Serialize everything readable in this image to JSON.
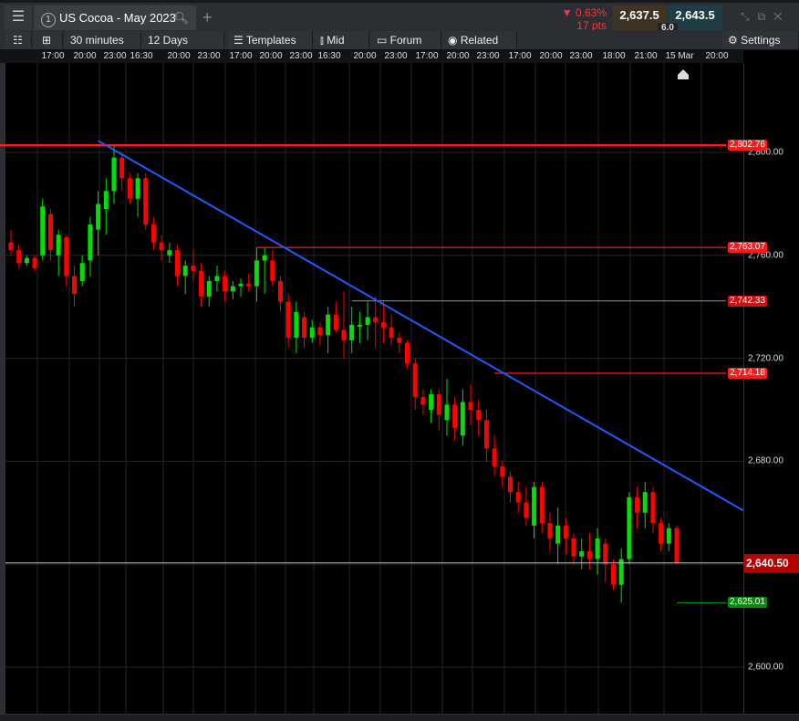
{
  "header": {
    "menu_icon": "hamburger-icon",
    "tab_number": "1",
    "title": "US Cocoa - May 2023",
    "add_tab": "+"
  },
  "quote": {
    "change_pct": "0.63%",
    "change_pts": "17 pts",
    "direction": "down",
    "sell": "2,637.5",
    "buy": "2,643.5",
    "spread": "6.0"
  },
  "toolbar": {
    "interval": "30 minutes",
    "range": "12 Days",
    "templates": "Templates",
    "price_type": "Mid",
    "forum": "Forum",
    "related": "Related",
    "settings": "Settings"
  },
  "chart_data": {
    "type": "candlestick",
    "time_labels": [
      "17:00",
      "20:00",
      "23:00",
      "16:30",
      "20:00",
      "23:00",
      "17:00",
      "20:00",
      "23:00",
      "16:30",
      "20:00",
      "23:00",
      "17:00",
      "20:00",
      "23:00",
      "17:00",
      "20:00",
      "23:00",
      "18:00",
      "21:00",
      "15 Mar",
      "20:00"
    ],
    "y_ticks": [
      "2,800.00",
      "2,760.00",
      "2,720.00",
      "2,680.00",
      "2,640.00",
      "2,600.00"
    ],
    "y_tick_values": [
      2800,
      2760,
      2720,
      2680,
      2640,
      2600
    ],
    "ylim": [
      2583,
      2835
    ],
    "grid": true,
    "colors": {
      "up": "#00e000",
      "down": "#ff0000",
      "trendline": "#1a5cff"
    },
    "ohlc": [
      [
        2765,
        2770,
        2760,
        2762
      ],
      [
        2762,
        2764,
        2755,
        2757
      ],
      [
        2757,
        2760,
        2756,
        2759
      ],
      [
        2759,
        2760,
        2754,
        2755
      ],
      [
        2760,
        2782,
        2758,
        2779
      ],
      [
        2776,
        2778,
        2758,
        2762
      ],
      [
        2760,
        2770,
        2752,
        2768
      ],
      [
        2767,
        2768,
        2748,
        2752
      ],
      [
        2752,
        2756,
        2740,
        2745
      ],
      [
        2750,
        2760,
        2748,
        2757
      ],
      [
        2758,
        2775,
        2752,
        2772
      ],
      [
        2770,
        2785,
        2760,
        2780
      ],
      [
        2778,
        2790,
        2768,
        2785
      ],
      [
        2785,
        2803,
        2780,
        2798
      ],
      [
        2798,
        2800,
        2785,
        2790
      ],
      [
        2790,
        2792,
        2780,
        2782
      ],
      [
        2782,
        2792,
        2775,
        2790
      ],
      [
        2790,
        2792,
        2770,
        2772
      ],
      [
        2772,
        2775,
        2762,
        2765
      ],
      [
        2765,
        2768,
        2758,
        2762
      ],
      [
        2760,
        2765,
        2757,
        2762
      ],
      [
        2762,
        2764,
        2748,
        2752
      ],
      [
        2752,
        2758,
        2745,
        2756
      ],
      [
        2756,
        2762,
        2750,
        2754
      ],
      [
        2754,
        2757,
        2740,
        2744
      ],
      [
        2744,
        2752,
        2740,
        2750
      ],
      [
        2750,
        2756,
        2746,
        2752
      ],
      [
        2752,
        2754,
        2742,
        2746
      ],
      [
        2746,
        2750,
        2743,
        2748
      ],
      [
        2748,
        2751,
        2744,
        2749
      ],
      [
        2749,
        2753,
        2746,
        2748
      ],
      [
        2748,
        2763,
        2742,
        2758
      ],
      [
        2758,
        2763,
        2745,
        2760
      ],
      [
        2758,
        2762,
        2748,
        2750
      ],
      [
        2750,
        2752,
        2738,
        2742
      ],
      [
        2742,
        2745,
        2725,
        2728
      ],
      [
        2728,
        2742,
        2722,
        2738
      ],
      [
        2736,
        2738,
        2724,
        2728
      ],
      [
        2728,
        2735,
        2726,
        2732
      ],
      [
        2732,
        2734,
        2725,
        2729
      ],
      [
        2729,
        2740,
        2722,
        2737
      ],
      [
        2737,
        2742,
        2730,
        2731
      ],
      [
        2731,
        2746,
        2720,
        2727
      ],
      [
        2727,
        2740,
        2722,
        2733
      ],
      [
        2733,
        2738,
        2726,
        2733
      ],
      [
        2733,
        2742,
        2727,
        2736
      ],
      [
        2736,
        2744,
        2724,
        2734
      ],
      [
        2734,
        2742,
        2726,
        2732
      ],
      [
        2732,
        2737,
        2725,
        2728
      ],
      [
        2728,
        2730,
        2722,
        2726
      ],
      [
        2726,
        2727,
        2716,
        2718
      ],
      [
        2718,
        2720,
        2700,
        2705
      ],
      [
        2705,
        2708,
        2698,
        2702
      ],
      [
        2700,
        2708,
        2695,
        2706
      ],
      [
        2706,
        2708,
        2692,
        2698
      ],
      [
        2696,
        2712,
        2690,
        2702
      ],
      [
        2702,
        2705,
        2688,
        2693
      ],
      [
        2690,
        2708,
        2686,
        2703
      ],
      [
        2703,
        2710,
        2694,
        2700
      ],
      [
        2700,
        2704,
        2690,
        2696
      ],
      [
        2696,
        2700,
        2680,
        2685
      ],
      [
        2685,
        2690,
        2674,
        2678
      ],
      [
        2678,
        2680,
        2670,
        2674
      ],
      [
        2674,
        2676,
        2664,
        2668
      ],
      [
        2668,
        2672,
        2660,
        2664
      ],
      [
        2664,
        2670,
        2655,
        2658
      ],
      [
        2655,
        2672,
        2650,
        2670
      ],
      [
        2670,
        2672,
        2652,
        2656
      ],
      [
        2656,
        2660,
        2645,
        2650
      ],
      [
        2648,
        2662,
        2640,
        2655
      ],
      [
        2655,
        2658,
        2644,
        2650
      ],
      [
        2650,
        2652,
        2640,
        2643
      ],
      [
        2643,
        2650,
        2638,
        2645
      ],
      [
        2645,
        2652,
        2638,
        2642
      ],
      [
        2642,
        2654,
        2636,
        2650
      ],
      [
        2648,
        2650,
        2633,
        2640
      ],
      [
        2640,
        2642,
        2630,
        2632
      ],
      [
        2632,
        2646,
        2625,
        2642
      ],
      [
        2642,
        2668,
        2640,
        2666
      ],
      [
        2666,
        2670,
        2654,
        2660
      ],
      [
        2660,
        2672,
        2654,
        2668
      ],
      [
        2668,
        2670,
        2652,
        2656
      ],
      [
        2656,
        2658,
        2645,
        2648
      ],
      [
        2648,
        2656,
        2645,
        2654
      ],
      [
        2654,
        2655,
        2640,
        2640.5
      ]
    ],
    "levels": [
      {
        "label": "2,802.76",
        "value": 2802.76,
        "color": "#ff1a1a",
        "from_index": -3
      },
      {
        "label": "2,763.07",
        "value": 2763.07,
        "color": "#ff1a1a",
        "from_index": 31
      },
      {
        "label": "2,742.33",
        "value": 2742.33,
        "color": "#777777",
        "from_index": 43
      },
      {
        "label": "2,714.18",
        "value": 2714.18,
        "color": "#ff1a1a",
        "from_index": 61
      },
      {
        "label": "2,625.01",
        "value": 2625.01,
        "color": "#0a8a0a",
        "from_index": 84
      }
    ],
    "current_price": {
      "label": "2,640.50",
      "value": 2640.5
    },
    "trendline": {
      "start_index": 11,
      "start_value": 2804.5,
      "end_index": 96,
      "end_value": 2654.5
    }
  }
}
